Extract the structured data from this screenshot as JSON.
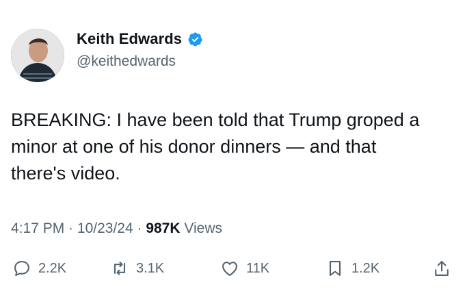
{
  "author": {
    "display_name": "Keith Edwards",
    "handle": "@keithedwards"
  },
  "tweet": {
    "text": "BREAKING: I have been told that Trump groped a\nminor at one of his donor dinners — and that\nthere's video."
  },
  "meta": {
    "time": "4:17 PM",
    "date": "10/23/24",
    "views_count": "987K",
    "views_label": "Views"
  },
  "actions": {
    "replies": "2.2K",
    "reposts": "3.1K",
    "likes": "11K",
    "bookmarks": "1.2K"
  },
  "colors": {
    "text": "#0f1419",
    "secondary": "#536471",
    "verified": "#1d9bf0"
  },
  "icons": [
    "verified-badge-icon",
    "reply-icon",
    "repost-icon",
    "like-icon",
    "bookmark-icon",
    "share-icon"
  ]
}
